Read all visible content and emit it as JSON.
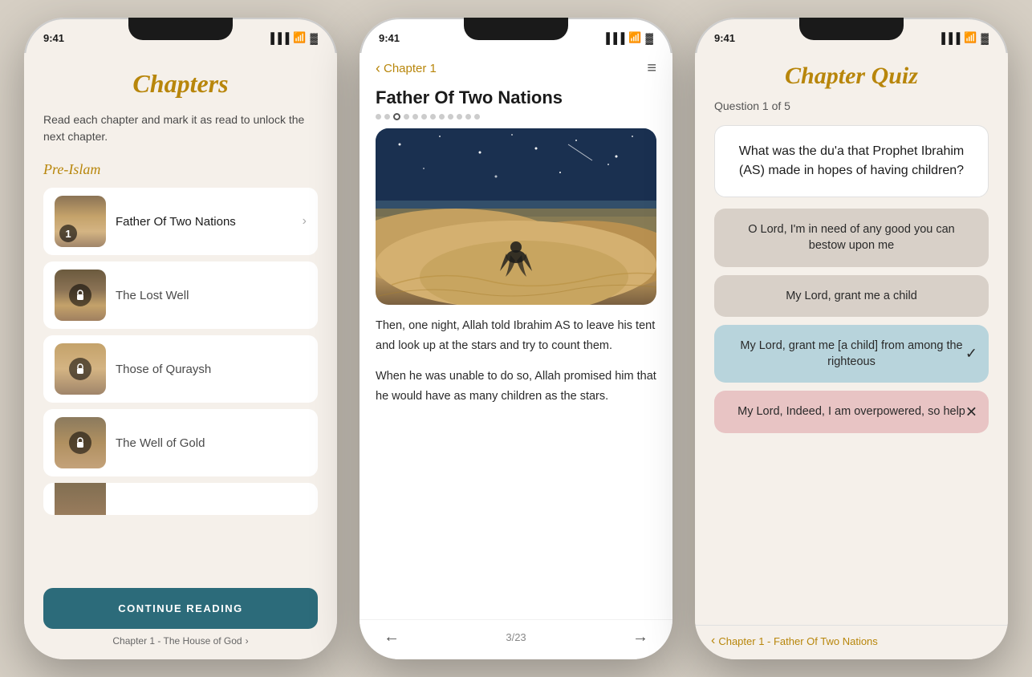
{
  "app": {
    "time": "9:41"
  },
  "phone1": {
    "title": "Chapters",
    "subtitle": "Read each chapter and mark it as read to unlock the next chapter.",
    "section": "Pre-Islam",
    "chapters": [
      {
        "id": 1,
        "name": "Father Of Two Nations",
        "locked": false,
        "num": "1"
      },
      {
        "id": 2,
        "name": "The Lost Well",
        "locked": true
      },
      {
        "id": 3,
        "name": "Those of Quraysh",
        "locked": true
      },
      {
        "id": 4,
        "name": "The Well of Gold",
        "locked": true
      },
      {
        "id": 5,
        "name": "...",
        "locked": true
      }
    ],
    "continue_btn": "CONTINUE READING",
    "continue_sub": "Chapter 1 - The House of God"
  },
  "phone2": {
    "back_label": "Chapter 1",
    "chapter_title": "Father Of Two Nations",
    "page_current": "3",
    "page_total": "23",
    "body_paragraphs": [
      "Then, one night, Allah told Ibrahim AS to leave his tent and look up at the stars and try to count them.",
      "When he was unable to do so, Allah promised him that he would have as many children as the stars."
    ]
  },
  "phone3": {
    "title": "Chapter Quiz",
    "progress": "Question 1 of 5",
    "question": "What was the du'a that Prophet Ibrahim (AS) made in hopes of having children?",
    "options": [
      {
        "text": "O Lord, I'm in need of any good you can bestow upon me",
        "state": "neutral"
      },
      {
        "text": "My Lord, grant me a child",
        "state": "neutral"
      },
      {
        "text": "My Lord, grant me [a child] from among the righteous",
        "state": "correct",
        "icon": "✓"
      },
      {
        "text": "My Lord, Indeed, I am overpowered, so help",
        "state": "wrong",
        "icon": "✗"
      }
    ],
    "footer": "Chapter 1 - Father Of Two Nations"
  }
}
